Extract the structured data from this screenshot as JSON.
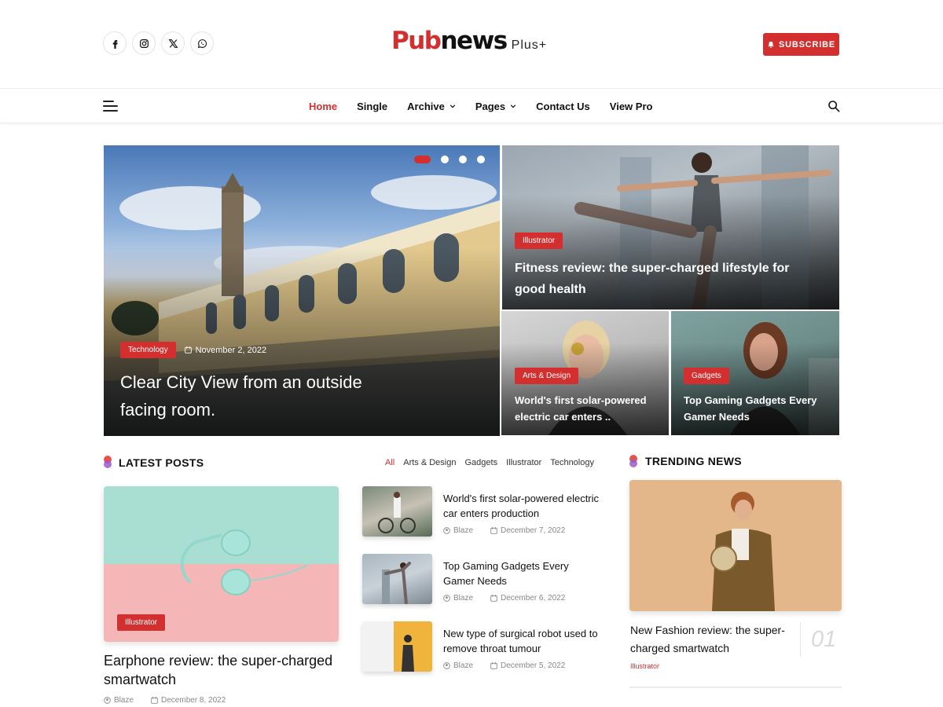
{
  "header": {
    "socials": [
      {
        "name": "facebook-icon"
      },
      {
        "name": "instagram-icon"
      },
      {
        "name": "x-icon"
      },
      {
        "name": "whatsapp-icon"
      }
    ],
    "logo": {
      "pub": "Pub",
      "news": "news",
      "plus": "Plus+"
    },
    "subscribe_label": "SUBSCRIBE"
  },
  "nav": {
    "items": [
      {
        "label": "Home",
        "active": true
      },
      {
        "label": "Single"
      },
      {
        "label": "Archive",
        "dropdown": true
      },
      {
        "label": "Pages",
        "dropdown": true
      },
      {
        "label": "Contact Us"
      },
      {
        "label": "View Pro"
      }
    ]
  },
  "hero": {
    "main": {
      "tag": "Technology",
      "date": "November 2, 2022",
      "title": "Clear City View from an outside facing room."
    },
    "slider_dots": 4,
    "top_right": {
      "tag": "Illustrator",
      "title": "Fitness review: the super-charged lifestyle for good health"
    },
    "bottom_left": {
      "tag": "Arts & Design",
      "title": "World's first solar-powered electric car enters .."
    },
    "bottom_right": {
      "tag": "Gadgets",
      "title": "Top Gaming Gadgets Every Gamer Needs"
    }
  },
  "latest": {
    "title": "LATEST POSTS",
    "filters": [
      "All",
      "Arts & Design",
      "Gadgets",
      "Illustrator",
      "Technology"
    ],
    "big_post": {
      "tag": "Illustrator",
      "title": "Earphone review: the super-charged smartwatch",
      "author": "Blaze",
      "date": "December 8, 2022"
    },
    "side_posts": [
      {
        "title": "World's first solar-powered electric car enters production",
        "author": "Blaze",
        "date": "December 7, 2022"
      },
      {
        "title": "Top Gaming Gadgets Every Gamer Needs",
        "author": "Blaze",
        "date": "December 6, 2022"
      },
      {
        "title": "New type of surgical robot used to remove throat tumour",
        "author": "Blaze",
        "date": "December 5, 2022"
      }
    ]
  },
  "trending": {
    "title": "TRENDING NEWS",
    "post": {
      "title": "New Fashion review: the super-charged smartwatch",
      "category": "Illustrator",
      "number": "01"
    }
  },
  "colors": {
    "accent": "#d32f2f",
    "dot_top": "#e5534b",
    "dot_bottom": "#9b59d0"
  }
}
